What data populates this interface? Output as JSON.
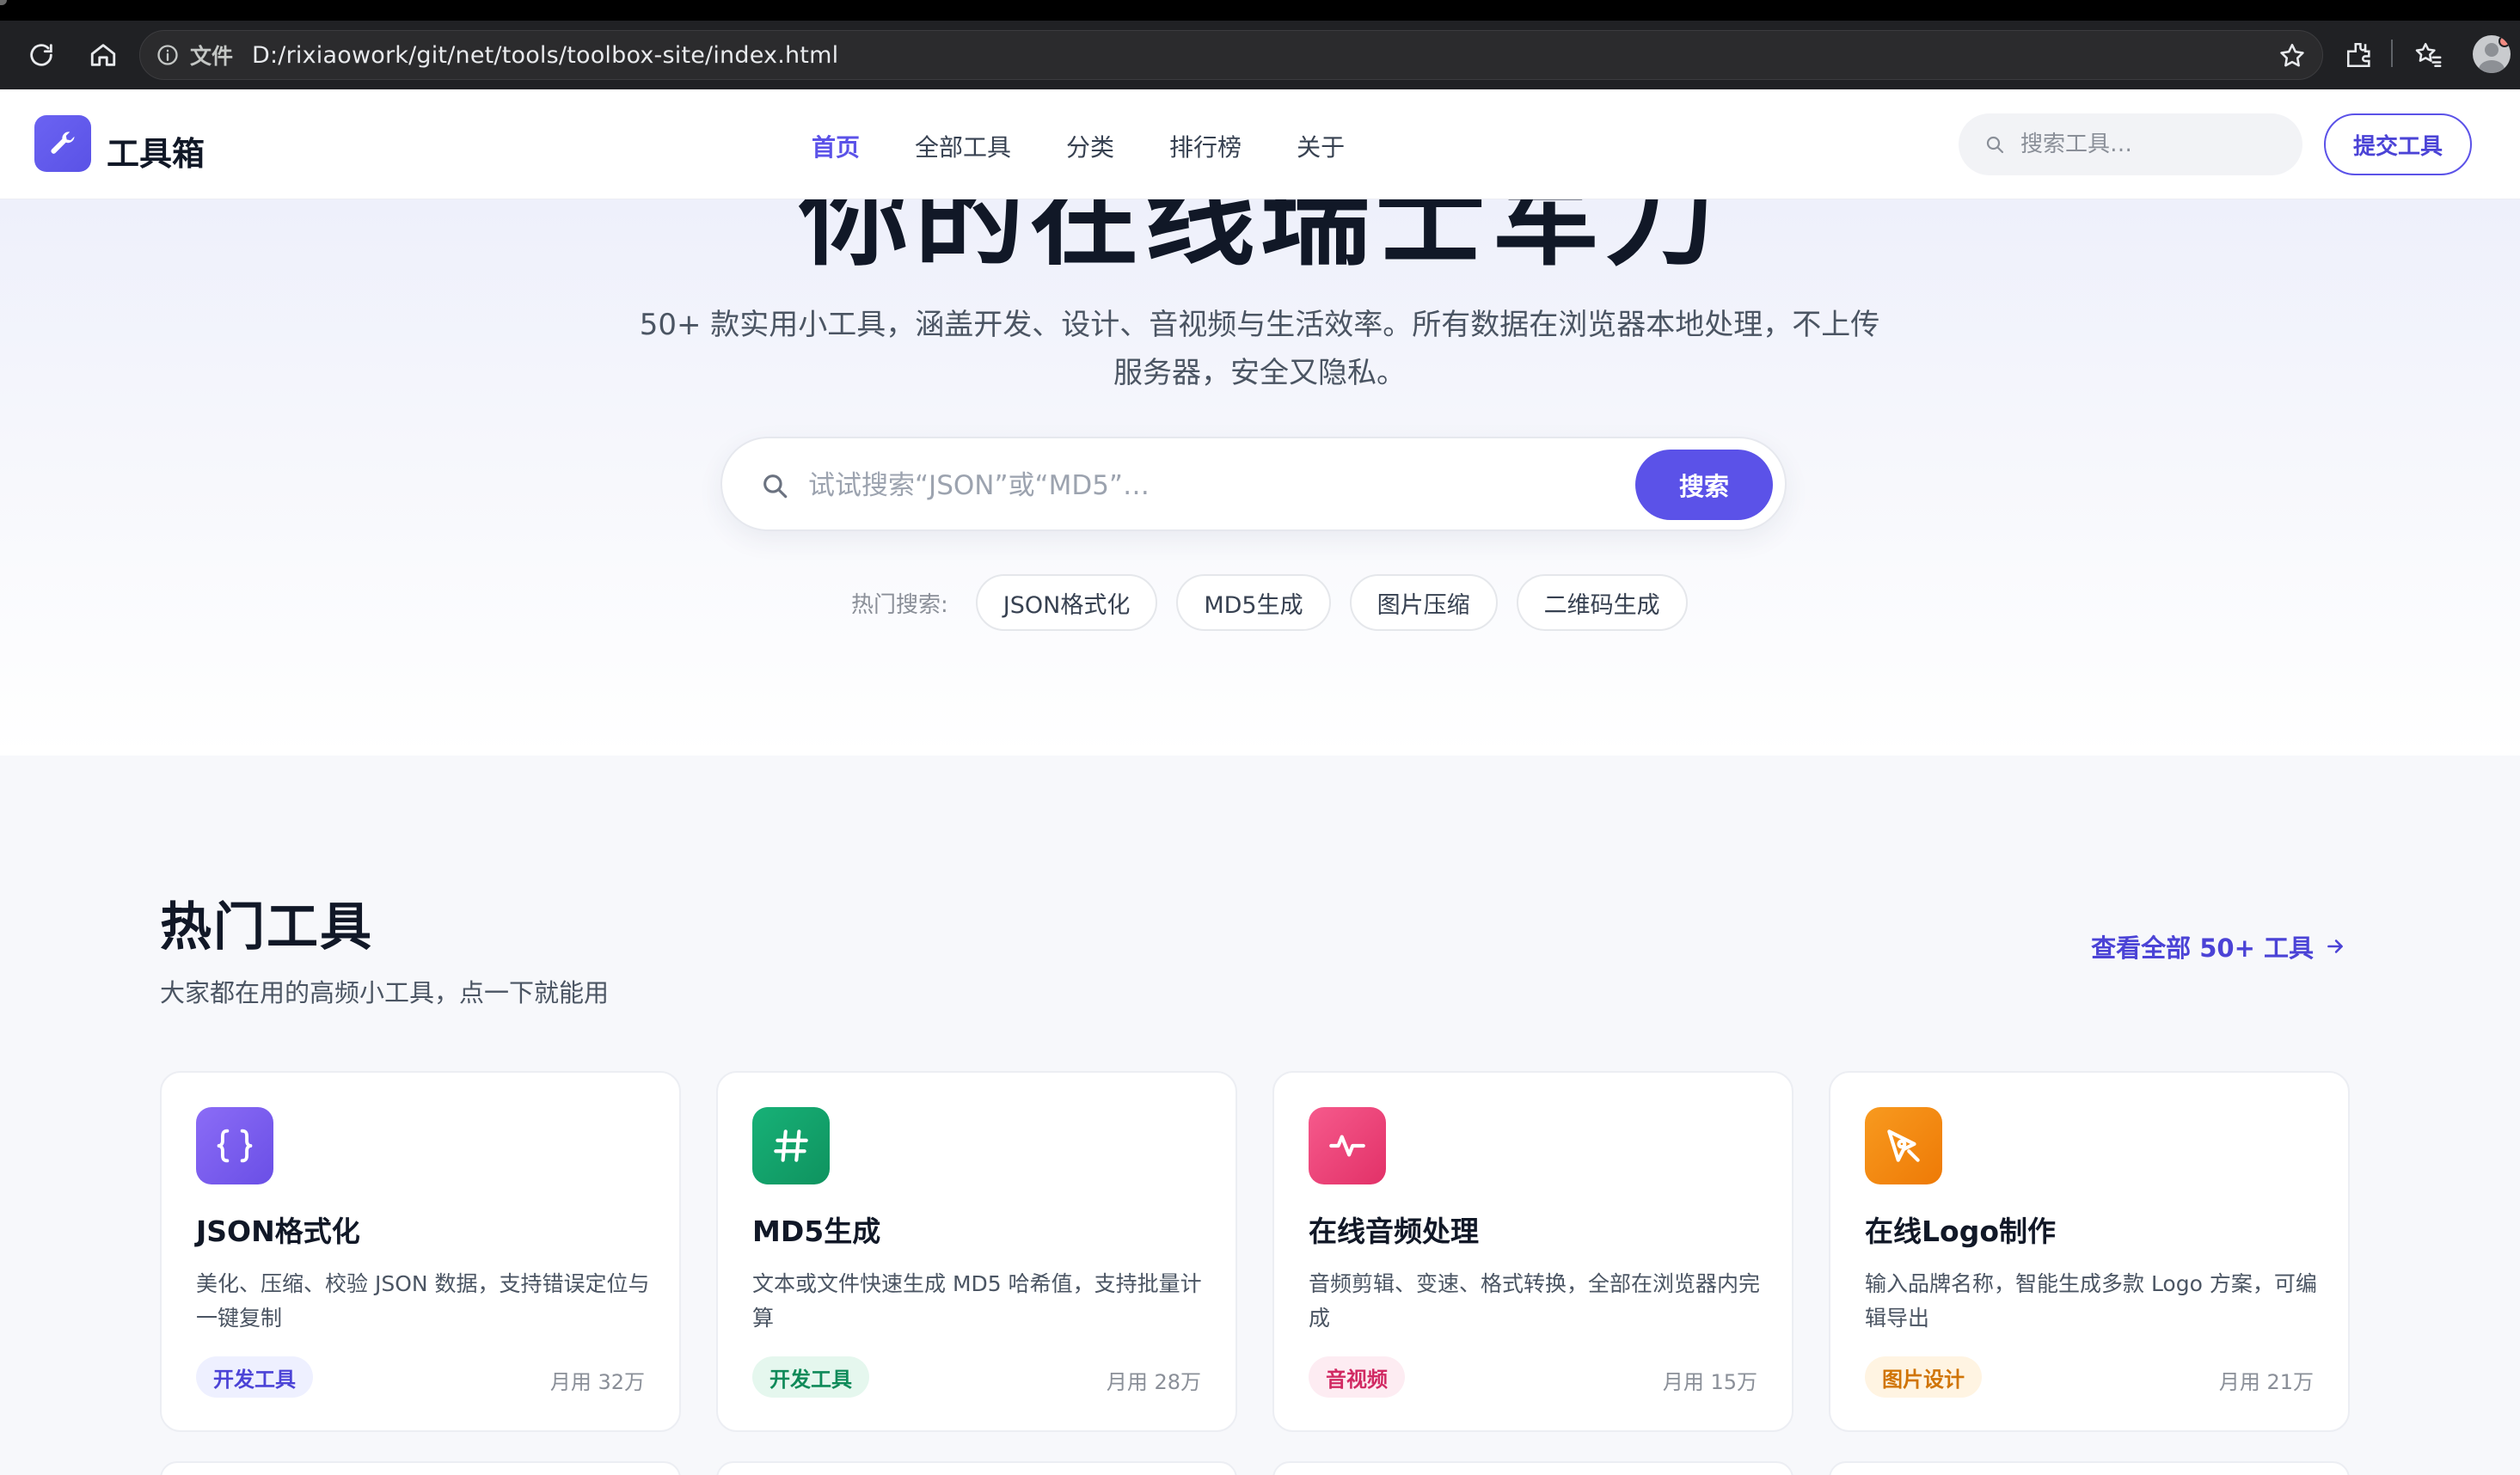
{
  "browser": {
    "protocol_label": "文件",
    "url": "D:/rixiaowork/git/net/tools/toolbox-site/index.html"
  },
  "header": {
    "logo_text": "工具箱",
    "nav": [
      {
        "label": "首页",
        "active": true
      },
      {
        "label": "全部工具",
        "active": false
      },
      {
        "label": "分类",
        "active": false
      },
      {
        "label": "排行榜",
        "active": false
      },
      {
        "label": "关于",
        "active": false
      }
    ],
    "search_placeholder": "搜索工具…",
    "submit_label": "提交工具"
  },
  "hero": {
    "title": "你的在线瑞士军刀",
    "subtitle": "50+ 款实用小工具，涵盖开发、设计、音视频与生活效率。所有数据在浏览器本地处理，不上传服务器，安全又隐私。",
    "search_placeholder": "试试搜索“JSON”或“MD5”…",
    "search_button": "搜索",
    "hot_label": "热门搜索:",
    "hot_terms": [
      "JSON格式化",
      "MD5生成",
      "图片压缩",
      "二维码生成"
    ]
  },
  "popular": {
    "title": "热门工具",
    "subtitle": "大家都在用的高频小工具，点一下就能用",
    "view_all": "查看全部 50+ 工具",
    "cards": [
      {
        "title": "JSON格式化",
        "desc": "美化、压缩、校验 JSON 数据，支持错误定位与一键复制",
        "tag": "开发工具",
        "uses": "月用 32万",
        "icon": "braces-icon",
        "icon_color": "#7a5cf0",
        "tag_bg": "#eef0ff",
        "tag_color": "#4b43d6"
      },
      {
        "title": "MD5生成",
        "desc": "文本或文件快速生成 MD5 哈希值，支持批量计算",
        "tag": "开发工具",
        "uses": "月用 28万",
        "icon": "hash-icon",
        "icon_color": "#12a06a",
        "tag_bg": "#e5f7ee",
        "tag_color": "#0f8a59"
      },
      {
        "title": "在线音频处理",
        "desc": "音频剪辑、变速、格式转换，全部在浏览器内完成",
        "tag": "音视频",
        "uses": "月用 15万",
        "icon": "waveform-icon",
        "icon_color": "#ee3f79",
        "tag_bg": "#fdecf2",
        "tag_color": "#d12a63"
      },
      {
        "title": "在线Logo制作",
        "desc": "输入品牌名称，智能生成多款 Logo 方案，可编辑导出",
        "tag": "图片设计",
        "uses": "月用 21万",
        "icon": "pen-tool-icon",
        "icon_color": "#f5870c",
        "tag_bg": "#fff4e2",
        "tag_color": "#d07406"
      }
    ]
  },
  "colors": {
    "accent": "#5b52e8",
    "browser_bg": "#202124"
  }
}
